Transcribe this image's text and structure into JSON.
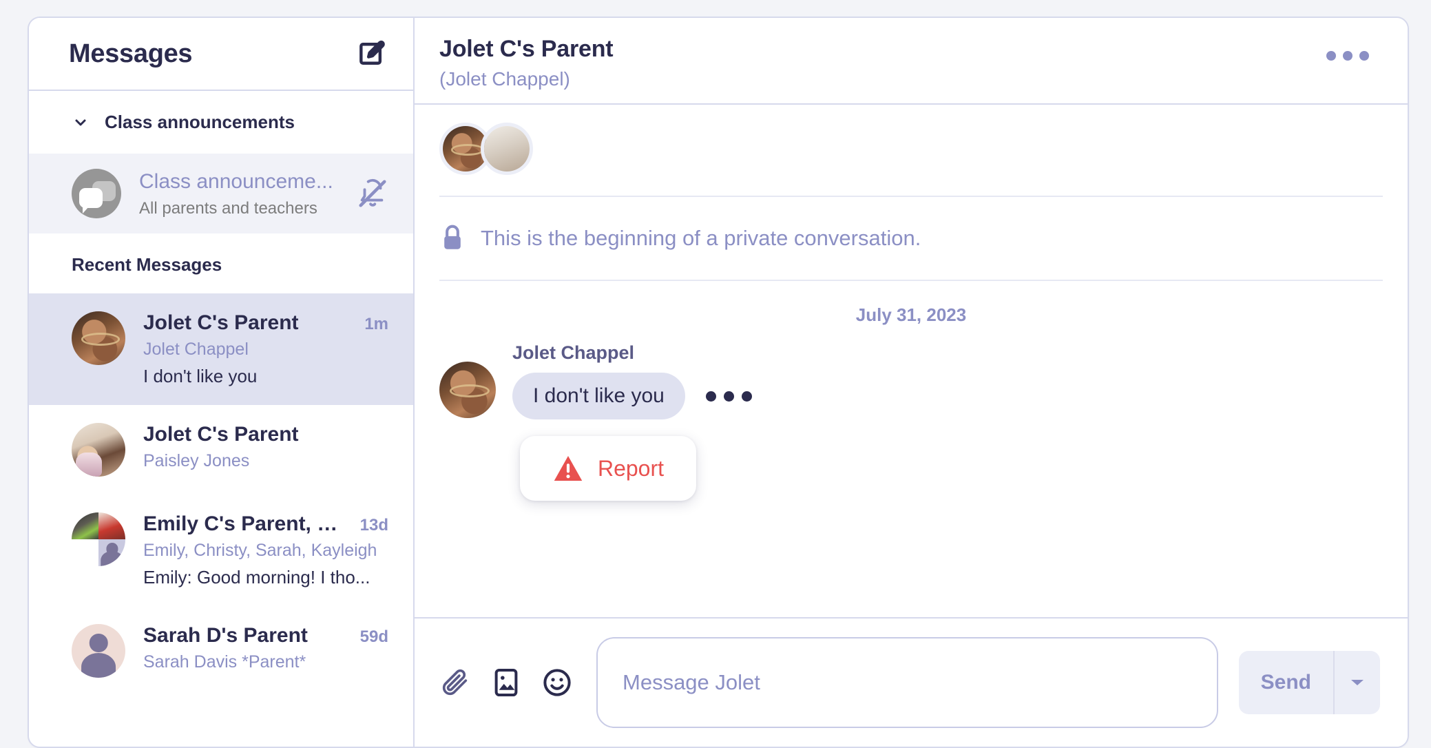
{
  "sidebar": {
    "title": "Messages",
    "compose_icon": "compose-pencil-icon",
    "sections": {
      "announcements": {
        "label": "Class announcements",
        "chevron_icon": "chevron-down-icon",
        "item": {
          "name": "Class announceme...",
          "subtitle": "All parents and teachers",
          "mute_icon": "bell-muted-icon"
        }
      },
      "recent": {
        "label": "Recent Messages"
      }
    },
    "conversations": [
      {
        "title": "Jolet C's Parent",
        "subtitle": "Jolet Chappel",
        "preview": "I don't like you",
        "time": "1m",
        "selected": true
      },
      {
        "title": "Jolet C's Parent",
        "subtitle": "Paisley Jones",
        "preview": "",
        "time": "",
        "selected": false
      },
      {
        "title": "Emily C's Parent, Ch...",
        "subtitle": "Emily, Christy, Sarah, Kayleigh",
        "preview": "Emily: Good morning! I tho...",
        "time": "13d",
        "selected": false
      },
      {
        "title": "Sarah D's Parent",
        "subtitle": "Sarah Davis *Parent*",
        "preview": "",
        "time": "59d",
        "selected": false
      }
    ]
  },
  "conversation": {
    "header": {
      "title": "Jolet C's Parent",
      "subtitle": "(Jolet Chappel)",
      "menu_icon": "ellipsis-horizontal-icon"
    },
    "private_notice": {
      "icon": "lock-icon",
      "text": "This is the beginning of a private conversation."
    },
    "date_separator": "July 31, 2023",
    "messages": [
      {
        "author": "Jolet Chappel",
        "text": "I don't like you",
        "actions_icon": "ellipsis-horizontal-icon"
      }
    ],
    "context_menu": {
      "icon": "warning-triangle-icon",
      "label": "Report"
    }
  },
  "composer": {
    "attach_icon": "paperclip-icon",
    "image_icon": "image-icon",
    "emoji_icon": "emoji-smiley-icon",
    "placeholder": "Message Jolet",
    "value": "",
    "send_label": "Send",
    "send_caret_icon": "caret-down-icon"
  },
  "colors": {
    "accent": "#8b8fc4",
    "text_dark": "#2b2b4d",
    "selected_bg": "#dfe1f0",
    "danger": "#e8514f",
    "border": "#d6d9ec",
    "page_bg": "#f3f4f8"
  }
}
